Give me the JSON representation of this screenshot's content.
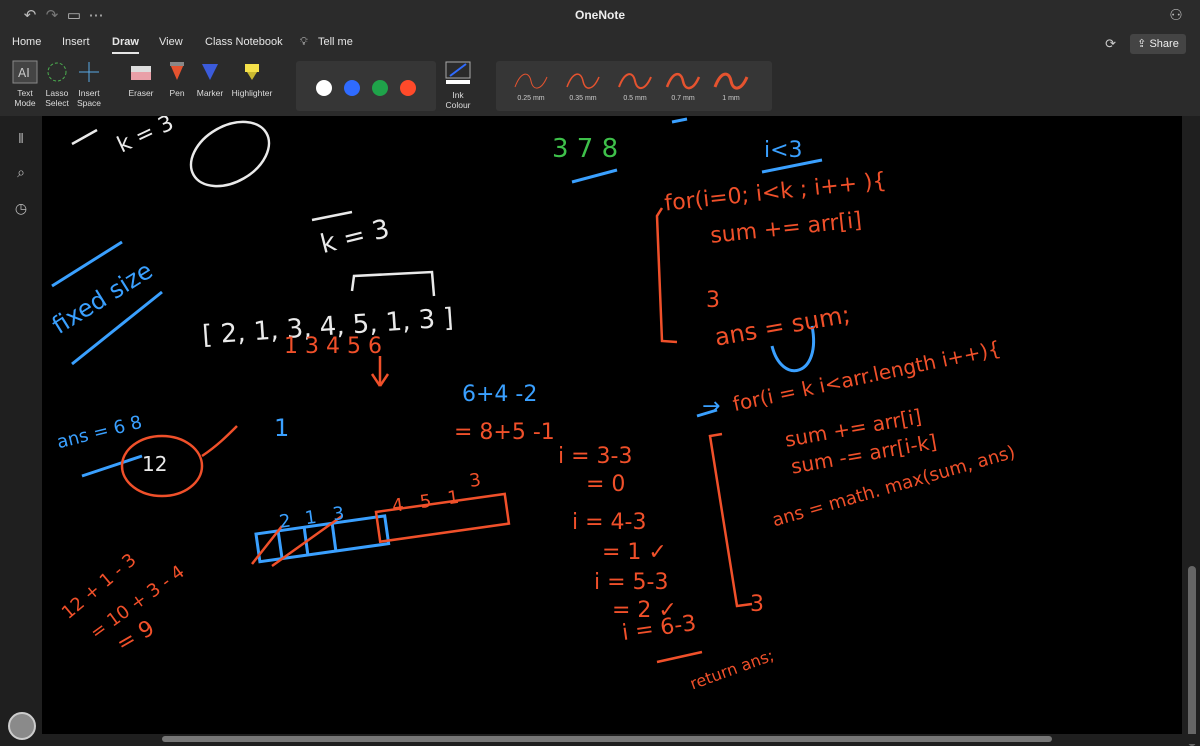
{
  "window": {
    "title": "OneNote"
  },
  "tabs": [
    "Home",
    "Insert",
    "Draw",
    "View",
    "Class Notebook",
    "Tell me"
  ],
  "header": {
    "share_label": "Share"
  },
  "ribbon": {
    "tools": [
      {
        "label": "Text\nMode"
      },
      {
        "label": "Lasso\nSelect"
      },
      {
        "label": "Insert\nSpace"
      },
      {
        "label": "Eraser"
      },
      {
        "label": "Pen"
      },
      {
        "label": "Marker"
      },
      {
        "label": "Highlighter"
      }
    ],
    "colors": [
      "#ffffff",
      "#2f6bff",
      "#1fa34a",
      "#ff4a2a"
    ],
    "ink_colour_label": "Ink\nColour",
    "pen_sizes": [
      "0.25 mm",
      "0.35 mm",
      "0.5 mm",
      "0.7 mm",
      "1 mm"
    ]
  },
  "notes": {
    "k_eq": "k = 3",
    "fixed": "fixed size",
    "array": "[ 2, 1, 3, 4, 5, 1, 3 ]",
    "idx": "1  3  4 5 6",
    "seq": "3 7 8",
    "i3": "i<3",
    "loop1": "for(i=0; i<k ; i++ ){",
    "sum1": "sum += arr[i]",
    "ans1": "ans = sum;",
    "loop2": "for(i = k  i<arr.length i++){",
    "sum2": "sum += arr[i]",
    "sum3": "sum -= arr[i-k]",
    "ans2": "ans = math. max(sum, ans)",
    "calc1": "6+4 -2",
    "calc2": "= 8+5 -1",
    "i1": "i = 3-3",
    "i1r": "= 0",
    "i2": "i = 4-3",
    "i2r": "= 1 ✓",
    "i3c": "i = 5-3",
    "i3r": "= 2 ✓",
    "i4": "i = 6-3",
    "ansv": "ans = 6  8",
    "twelve": "12",
    "c1": "12 + 1 - 3",
    "c2": "= 10 + 3 - 4",
    "c3": "= 9",
    "retc": "return ans;",
    "boxes": [
      "2",
      "1",
      "3",
      "4",
      "5",
      "1",
      "3"
    ]
  }
}
